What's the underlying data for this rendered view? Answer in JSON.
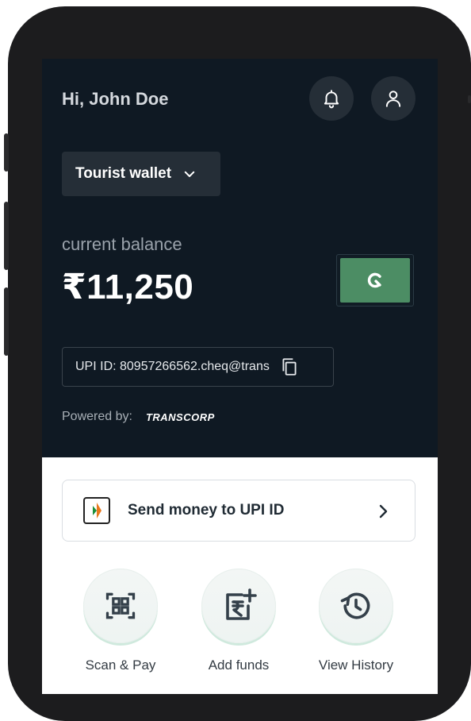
{
  "header": {
    "greeting": "Hi, John Doe",
    "bell_icon": "bell-icon",
    "profile_icon": "user-icon"
  },
  "wallet": {
    "selected": "Tourist wallet"
  },
  "balance": {
    "label": "current balance",
    "value": "₹11,250"
  },
  "upi": {
    "text": "UPI ID: 80957266562.cheq@trans"
  },
  "powered": {
    "label": "Powered by:",
    "brand": "TRANSCORP"
  },
  "send": {
    "label": "Send money to UPI ID"
  },
  "actions": [
    {
      "label": "Scan & Pay",
      "icon": "qr-scan-icon"
    },
    {
      "label": "Add funds",
      "icon": "add-funds-icon"
    },
    {
      "label": "View History",
      "icon": "history-icon"
    }
  ],
  "colors": {
    "dark_bg": "#0f1923",
    "card_bg": "#252e37",
    "cheq_green": "#4c8d64",
    "action_ring": "#cfe9dd"
  }
}
